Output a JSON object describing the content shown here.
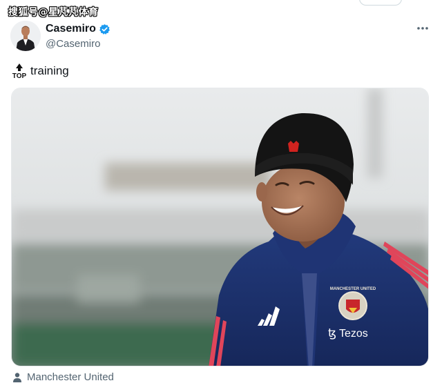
{
  "watermark": {
    "text": "搜狐号@星芃芃体育"
  },
  "tweet": {
    "author": {
      "name": "Casemiro",
      "handle": "@Casemiro",
      "verified": true,
      "avatar_icon": "avatar-suited-man"
    },
    "text": "training",
    "emoji_icon": "top-arrow-emoji",
    "emoji_label": "TOP",
    "more_icon": "ellipsis-icon",
    "media": {
      "description_icon": "photo",
      "crest_text": "MANCHESTER UNITED",
      "sponsor": "Tezos"
    },
    "tagged": {
      "icon": "person-icon",
      "label": "Manchester United"
    }
  },
  "colors": {
    "verified": "#1d9bf0",
    "secondary_text": "#536471",
    "jacket": "#1c2f6b",
    "hat": "#141414",
    "hat_logo": "#d0231f"
  }
}
